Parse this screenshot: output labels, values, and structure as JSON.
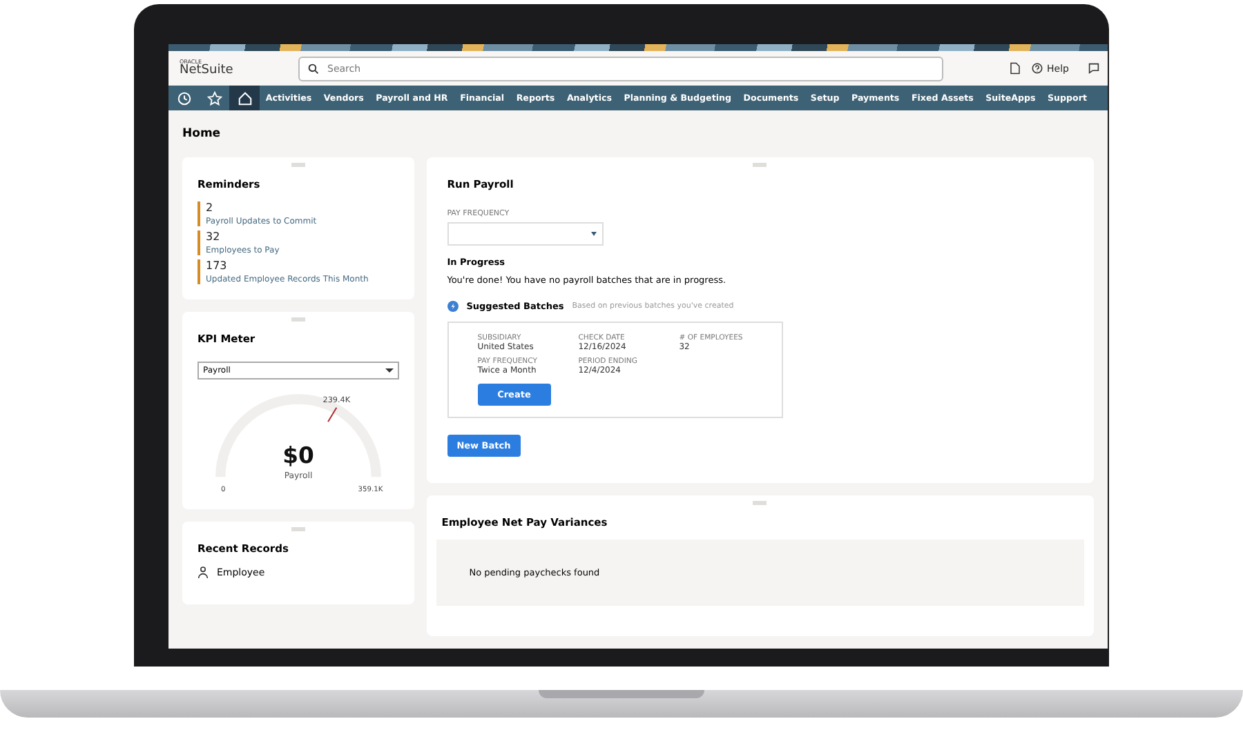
{
  "header": {
    "logo_top": "ORACLE",
    "logo": "NetSuite",
    "search": {
      "placeholder": "Search"
    },
    "help": "Help"
  },
  "nav": {
    "icon_tabs": [
      {
        "selected": false
      },
      {
        "selected": false
      },
      {
        "selected": true
      }
    ],
    "items": [
      "Activities",
      "Vendors",
      "Payroll and HR",
      "Financial",
      "Reports",
      "Analytics",
      "Planning & Budgeting",
      "Documents",
      "Setup",
      "Payments",
      "Fixed Assets",
      "SuiteApps",
      "Support"
    ]
  },
  "page_title": "Home",
  "reminders": {
    "title": "Reminders",
    "items": [
      {
        "count": "2",
        "label": "Payroll Updates to Commit"
      },
      {
        "count": "32",
        "label": "Employees to Pay"
      },
      {
        "count": "173",
        "label": "Updated Employee Records This Month"
      }
    ]
  },
  "kpi_meter": {
    "title": "KPI Meter",
    "select": "Payroll",
    "value": "$0",
    "caption": "Payroll",
    "min": "0",
    "max": "359.1K",
    "target": "239.4K"
  },
  "recent_records": {
    "title": "Recent Records",
    "items": [
      "Employee"
    ]
  },
  "run_payroll": {
    "title": "Run Payroll",
    "pay_frequency_label": "PAY FREQUENCY",
    "in_progress_title": "In Progress",
    "in_progress_text": "You're done! You have no payroll batches that are in progress.",
    "suggested_title": "Suggested Batches",
    "suggested_hint": "Based on previous batches you've created",
    "batch": {
      "fields": [
        {
          "label": "SUBSIDIARY",
          "value": "United States"
        },
        {
          "label": "CHECK DATE",
          "value": "12/16/2024"
        },
        {
          "label": "# OF EMPLOYEES",
          "value": "32"
        },
        {
          "label": "PAY FREQUENCY",
          "value": "Twice a Month"
        },
        {
          "label": "PERIOD ENDING",
          "value": "12/4/2024"
        }
      ],
      "button": "Create"
    },
    "new_batch": "New Batch"
  },
  "variances": {
    "title": "Employee Net Pay Variances",
    "empty": "No pending paychecks found"
  }
}
